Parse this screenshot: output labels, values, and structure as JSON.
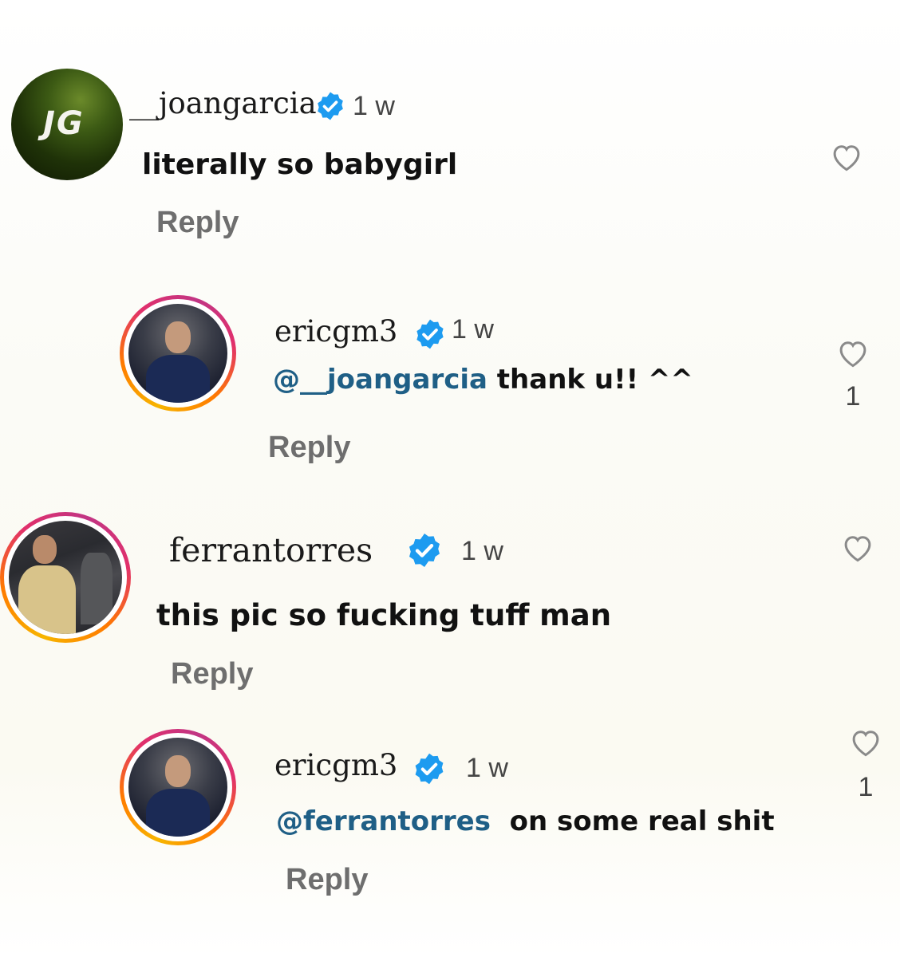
{
  "comments": [
    {
      "username": "__joangarcia",
      "time": "1 w",
      "text": "literally so babygirl",
      "reply_label": "Reply",
      "avatar_logo": "JG",
      "likes": ""
    },
    {
      "username": "ericgm3",
      "time": "1 w",
      "mention": "@__joangarcia",
      "text": " thank u!! ^^",
      "reply_label": "Reply",
      "likes": "1"
    },
    {
      "username": "ferrantorres",
      "time": "1 w",
      "text": "this pic so fucking tuff man",
      "reply_label": "Reply",
      "likes": ""
    },
    {
      "username": "ericgm3",
      "time": "1 w",
      "mention": "@ferrantorres",
      "text": "  on some real shit",
      "reply_label": "Reply",
      "likes": "1"
    }
  ],
  "colors": {
    "verified_blue": "#1d9bf0",
    "mention_blue": "#1f5f86",
    "reply_gray": "#6e6e6e"
  },
  "icons": [
    "verified-badge-icon",
    "heart-icon"
  ]
}
